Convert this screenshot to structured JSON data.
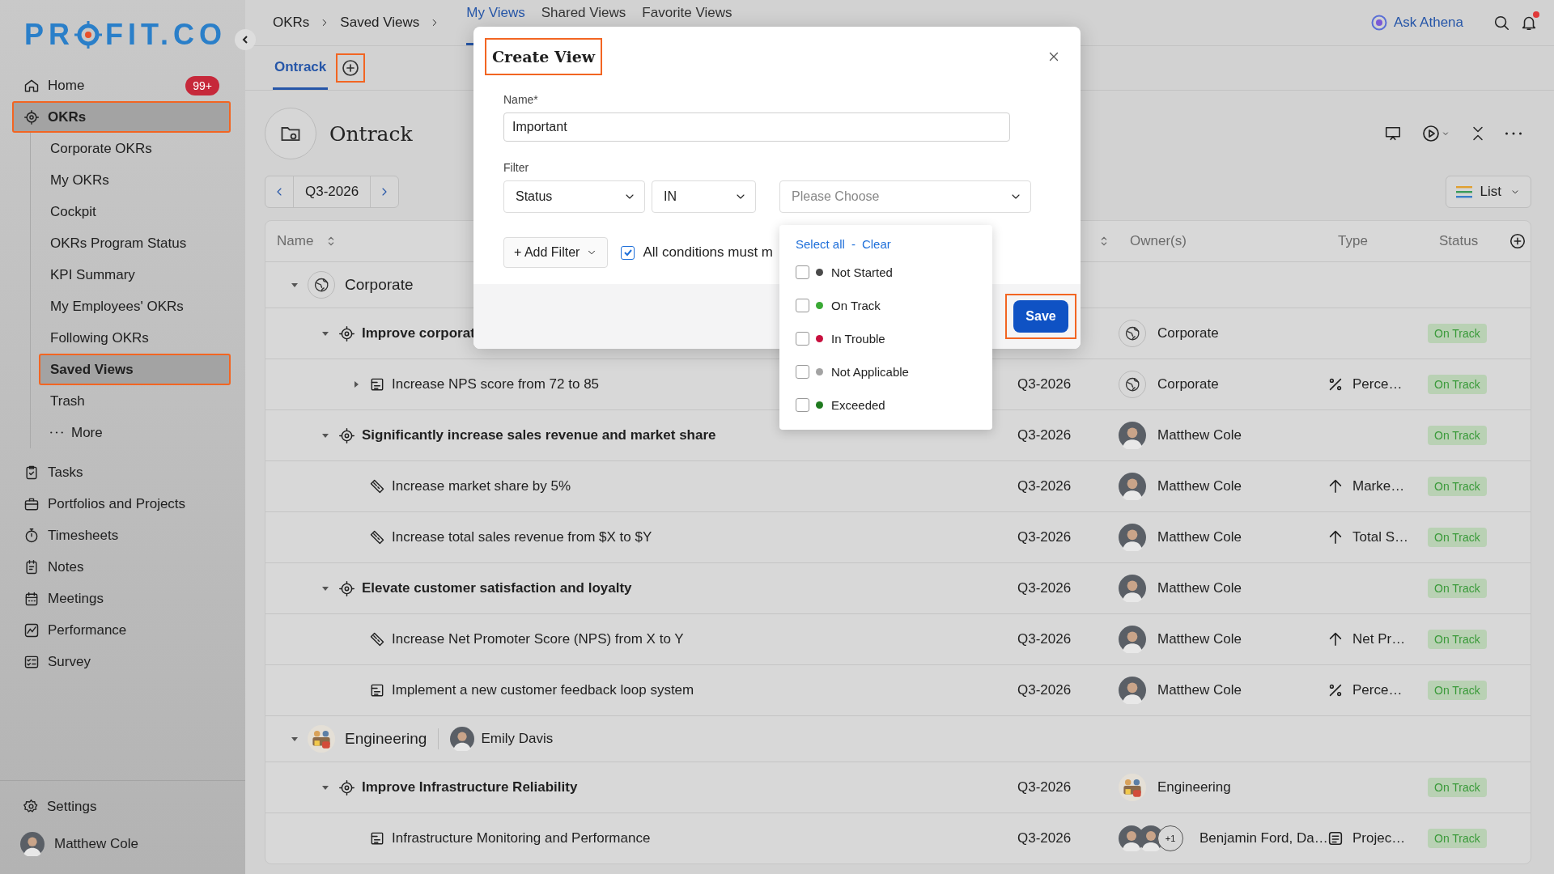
{
  "sidebar": {
    "logo": {
      "before": "PR",
      "after": "FIT.CO"
    },
    "nav": [
      {
        "label": "Home",
        "badge": "99+",
        "selected": false,
        "highlighted": false
      },
      {
        "label": "OKRs",
        "selected": true,
        "highlighted": true,
        "children": [
          {
            "label": "Corporate OKRs",
            "kind": "link",
            "selected": false,
            "highlighted": false
          },
          {
            "label": "My OKRs",
            "kind": "link",
            "selected": false,
            "highlighted": false
          },
          {
            "label": "Cockpit",
            "kind": "link",
            "selected": false,
            "highlighted": false
          },
          {
            "label": "OKRs Program Status",
            "kind": "link",
            "selected": false,
            "highlighted": false
          },
          {
            "label": "KPI Summary",
            "kind": "link",
            "selected": false,
            "highlighted": false
          },
          {
            "label": "My Employees' OKRs",
            "kind": "link",
            "selected": false,
            "highlighted": false
          },
          {
            "label": "Following OKRs",
            "kind": "link",
            "selected": false,
            "highlighted": false
          },
          {
            "label": "Saved Views",
            "kind": "link",
            "selected": true,
            "highlighted": true
          },
          {
            "label": "Trash",
            "kind": "link",
            "selected": false,
            "highlighted": false
          },
          {
            "label": "More",
            "kind": "more",
            "selected": false,
            "highlighted": false
          }
        ]
      },
      {
        "label": "Tasks",
        "selected": false,
        "highlighted": false
      },
      {
        "label": "Portfolios and Projects",
        "selected": false,
        "highlighted": false
      },
      {
        "label": "Timesheets",
        "selected": false,
        "highlighted": false
      },
      {
        "label": "Notes",
        "selected": false,
        "highlighted": false
      },
      {
        "label": "Meetings",
        "selected": false,
        "highlighted": false
      },
      {
        "label": "Performance",
        "selected": false,
        "highlighted": false
      },
      {
        "label": "Survey",
        "selected": false,
        "highlighted": false
      }
    ],
    "settings": "Settings",
    "user": {
      "name": "Matthew Cole"
    }
  },
  "topbar": {
    "breadcrumbs": [
      "OKRs",
      "Saved Views"
    ],
    "view_tabs": [
      {
        "label": "My Views",
        "selected": true
      },
      {
        "label": "Shared Views",
        "selected": false
      },
      {
        "label": "Favorite Views",
        "selected": false
      }
    ],
    "assistant": "Ask Athena",
    "unread_notifications": true
  },
  "page_tabs": [
    {
      "label": "Ontrack",
      "selected": true
    }
  ],
  "add_tab": {
    "highlighted": true
  },
  "view": {
    "title": "Ontrack",
    "period": "Q3-2026",
    "mode": "List"
  },
  "table": {
    "columns": [
      {
        "label": "Name",
        "sortable": true
      },
      {
        "sortable": true
      },
      {
        "label": "Owner(s)",
        "sortable": false
      },
      {
        "label": "Type",
        "sortable": false
      },
      {
        "label": "Status",
        "sortable": false
      }
    ],
    "rows": [
      {
        "kind": "group",
        "name": "Corporate",
        "expanded": true,
        "children": [
          {
            "kind": "objective",
            "name": "Improve corporat",
            "expanded": true,
            "owner": {
              "kind": "globe",
              "name": "Corporate"
            },
            "status": "On Track",
            "children": [
              {
                "kind": "list",
                "name": "Increase NPS score from 72 to 85",
                "expanded": false,
                "period": "Q3-2026",
                "owner": {
                  "kind": "globe",
                  "name": "Corporate"
                },
                "type": {
                  "kind": "percent",
                  "label": "Perce…"
                },
                "status": "On Track"
              }
            ]
          },
          {
            "kind": "objective",
            "name": "Significantly increase sales revenue and market share",
            "expanded": true,
            "period": "Q3-2026",
            "owner": {
              "kind": "person",
              "name": "Matthew Cole"
            },
            "status": "On Track",
            "children": [
              {
                "kind": "metric",
                "name": "Increase market share by 5%",
                "period": "Q3-2026",
                "owner": {
                  "kind": "person",
                  "name": "Matthew Cole"
                },
                "type": {
                  "kind": "arrow",
                  "label": "Marke…"
                },
                "status": "On Track"
              },
              {
                "kind": "metric",
                "name": "Increase total sales revenue from $X to $Y",
                "period": "Q3-2026",
                "owner": {
                  "kind": "person",
                  "name": "Matthew Cole"
                },
                "type": {
                  "kind": "arrow",
                  "label": "Total S…"
                },
                "status": "On Track"
              }
            ]
          },
          {
            "kind": "objective",
            "name": "Elevate customer satisfaction and loyalty",
            "expanded": true,
            "period": "Q3-2026",
            "owner": {
              "kind": "person",
              "name": "Matthew Cole"
            },
            "status": "On Track",
            "children": [
              {
                "kind": "metric",
                "name": "Increase Net Promoter Score (NPS) from X to Y",
                "period": "Q3-2026",
                "owner": {
                  "kind": "person",
                  "name": "Matthew Cole"
                },
                "type": {
                  "kind": "arrow",
                  "label": "Net Pr…"
                },
                "status": "On Track"
              },
              {
                "kind": "list",
                "name": "Implement a new customer feedback loop system",
                "period": "Q3-2026",
                "owner": {
                  "kind": "person",
                  "name": "Matthew Cole"
                },
                "type": {
                  "kind": "percent",
                  "label": "Perce…"
                },
                "status": "On Track"
              }
            ]
          }
        ]
      },
      {
        "kind": "group",
        "name": "Engineering",
        "lead": "Emily Davis",
        "expanded": true,
        "children": [
          {
            "kind": "objective",
            "name": "Improve Infrastructure Reliability",
            "expanded": true,
            "period": "Q3-2026",
            "owner": {
              "kind": "team",
              "name": "Engineering"
            },
            "status": "On Track",
            "children": [
              {
                "kind": "list",
                "name": "Infrastructure Monitoring and Performance",
                "period": "Q3-2026",
                "owner": {
                  "kind": "multi",
                  "name": "Benjamin Ford, Da…",
                  "extra": "+1"
                },
                "type": {
                  "kind": "document",
                  "label": "Projec…"
                },
                "status": "On Track"
              }
            ]
          }
        ]
      }
    ]
  },
  "modal": {
    "title": "Create View",
    "title_highlighted": true,
    "name_label": "Name*",
    "name_value": "Important",
    "filter_label": "Filter",
    "filters": [
      {
        "value": "Status"
      },
      {
        "value": "IN"
      },
      {
        "placeholder": "Please Choose"
      }
    ],
    "add_filter": "+ Add Filter",
    "match_all": {
      "label": "All conditions must m",
      "checked": true
    },
    "dropdown": {
      "select_all": "Select all",
      "separator": "-",
      "clear": "Clear",
      "options": [
        {
          "label": "Not Started",
          "color": "#4a4a4a",
          "checked": false
        },
        {
          "label": "On Track",
          "color": "#3aa935",
          "checked": false
        },
        {
          "label": "In Trouble",
          "color": "#c8103e",
          "checked": false
        },
        {
          "label": "Not Applicable",
          "color": "#a3a3a3",
          "checked": false
        },
        {
          "label": "Exceeded",
          "color": "#1f7a1f",
          "checked": false
        }
      ]
    },
    "save": {
      "label": "Save",
      "highlighted": true
    }
  }
}
